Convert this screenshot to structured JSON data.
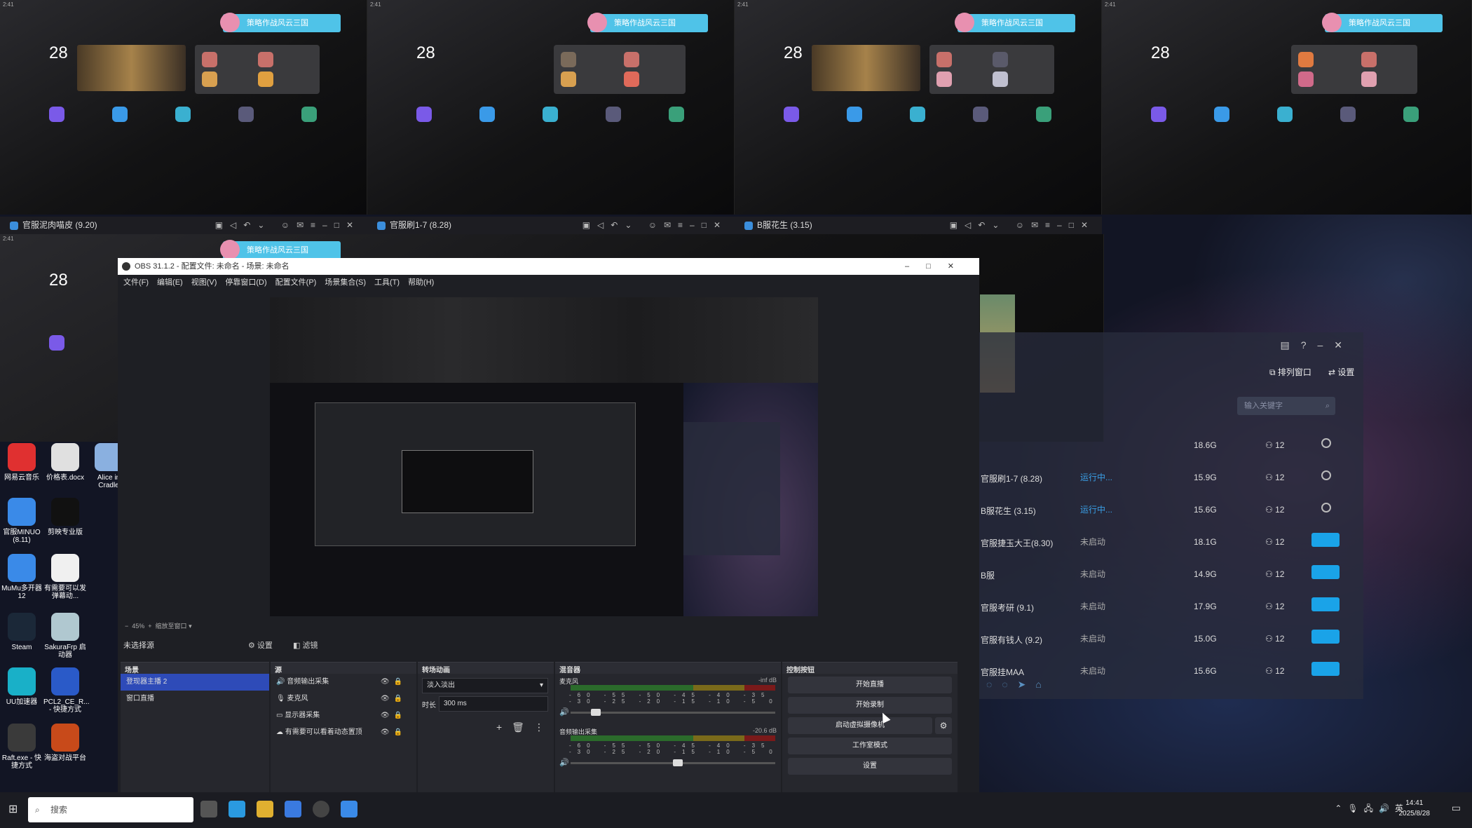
{
  "tiles": [
    {
      "clock": "28",
      "status": "2:41",
      "notice": "策略作战风云三国"
    },
    {
      "clock": "28",
      "status": "2:41",
      "notice": "策略作战风云三国"
    },
    {
      "clock": "28",
      "status": "2:41",
      "notice": "策略作战风云三国"
    },
    {
      "clock": "28",
      "status": "2:41",
      "notice": "策略作战风云三国"
    },
    {
      "clock": "28",
      "status": "2:41",
      "notice": "策略作战风云三国"
    }
  ],
  "tile_titles": [
    "官服泥肉喵皮 (9.20)",
    "官服刷1-7 (8.28)",
    "B服花生 (3.15)"
  ],
  "manager": {
    "arrange_label": "排列窗口",
    "settings_label": "设置",
    "search_placeholder": "输入关键字",
    "rows": [
      {
        "name": "",
        "status": "",
        "size": "18.6G",
        "cpu": "12",
        "running": true
      },
      {
        "name": "官服刷1-7 (8.28)",
        "status": "运行中...",
        "size": "15.9G",
        "cpu": "12",
        "running": true
      },
      {
        "name": "B服花生 (3.15)",
        "status": "运行中...",
        "size": "15.6G",
        "cpu": "12",
        "running": true
      },
      {
        "name": "官服捷玉大王(8.30)",
        "status": "未启动",
        "size": "18.1G",
        "cpu": "12",
        "running": false
      },
      {
        "name": "B服",
        "status": "未启动",
        "size": "14.9G",
        "cpu": "12",
        "running": false
      },
      {
        "name": "官服考研 (9.1)",
        "status": "未启动",
        "size": "17.9G",
        "cpu": "12",
        "running": false
      },
      {
        "name": "官服有钱人 (9.2)",
        "status": "未启动",
        "size": "15.0G",
        "cpu": "12",
        "running": false
      },
      {
        "name": "官服挂MAA",
        "status": "未启动",
        "size": "15.6G",
        "cpu": "12",
        "running": false
      }
    ]
  },
  "desktop_icons": [
    {
      "label": "网易云音乐",
      "color": "#e03030"
    },
    {
      "label": "价格表.docx",
      "color": "#e0e0e0"
    },
    {
      "label": "Alice in Cradle",
      "color": "#8ab0e0"
    },
    {
      "label": "官服MINUO (8.11)",
      "color": "#3a8ae8"
    },
    {
      "label": "剪映专业版",
      "color": "#111111"
    },
    {
      "label": "MuMu多开器12",
      "color": "#3a8ae8"
    },
    {
      "label": "有需要可以发弹幕动...",
      "color": "#f0f0f0"
    },
    {
      "label": "Steam",
      "color": "#1b2838"
    },
    {
      "label": "SakuraFrp 启动器",
      "color": "#b0c8d0"
    },
    {
      "label": "UU加速器",
      "color": "#19b0c8"
    },
    {
      "label": "PCL2_CE_R... - 快捷方式",
      "color": "#2a5ac8"
    },
    {
      "label": "Raft.exe - 快捷方式",
      "color": "#3a3a3a"
    },
    {
      "label": "海盗对战平台",
      "color": "#c84a1a"
    }
  ],
  "obs": {
    "title": "OBS 31.1.2 - 配置文件: 未命名 - 场景: 未命名",
    "menu": [
      "文件(F)",
      "编辑(E)",
      "视图(V)",
      "停靠窗口(D)",
      "配置文件(P)",
      "场景集合(S)",
      "工具(T)",
      "帮助(H)"
    ],
    "zoom": "45%",
    "zoom_mode": "缩放至窗口",
    "no_source": "未选择源",
    "props_label": "设置",
    "filters_label": "滤镜",
    "scenes_title": "场景",
    "scenes": [
      "登现器主播 2",
      "窗口直播"
    ],
    "sources_title": "源",
    "sources": [
      "音频输出采集",
      "麦克风",
      "显示器采集",
      "有需要可以看着动态置顶"
    ],
    "transitions_title": "转场动画",
    "transition": "淡入淡出",
    "duration_label": "时长",
    "duration": "300 ms",
    "mixer_title": "混音器",
    "mixer": [
      {
        "name": "麦克风",
        "db": "-inf dB",
        "volume": 0.1
      },
      {
        "name": "音频输出采集",
        "db": "-20.6 dB",
        "volume": 0.5
      }
    ],
    "meter_ticks": "-60 -55 -50 -45 -40 -35 -30 -25 -20 -15 -10 -5 0",
    "controls_title": "控制按钮",
    "controls": [
      "开始直播",
      "开始录制",
      "启动虚拟摄像机",
      "工作室模式",
      "设置"
    ]
  },
  "taskbar": {
    "search": "搜索",
    "lang": "英",
    "time": "14:41",
    "date": "2025/8/28"
  }
}
